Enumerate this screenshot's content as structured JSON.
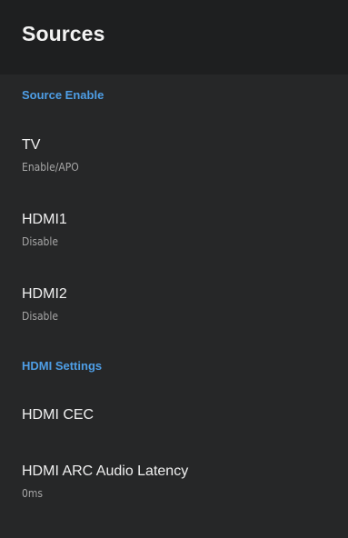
{
  "header": {
    "title": "Sources"
  },
  "sections": [
    {
      "title": "Source Enable",
      "items": [
        {
          "title": "TV",
          "summary": "Enable/APO"
        },
        {
          "title": "HDMI1",
          "summary": "Disable"
        },
        {
          "title": "HDMI2",
          "summary": "Disable"
        }
      ]
    },
    {
      "title": "HDMI Settings",
      "items": [
        {
          "title": "HDMI CEC"
        },
        {
          "title": "HDMI ARC Audio Latency",
          "summary": "0ms"
        }
      ]
    }
  ]
}
